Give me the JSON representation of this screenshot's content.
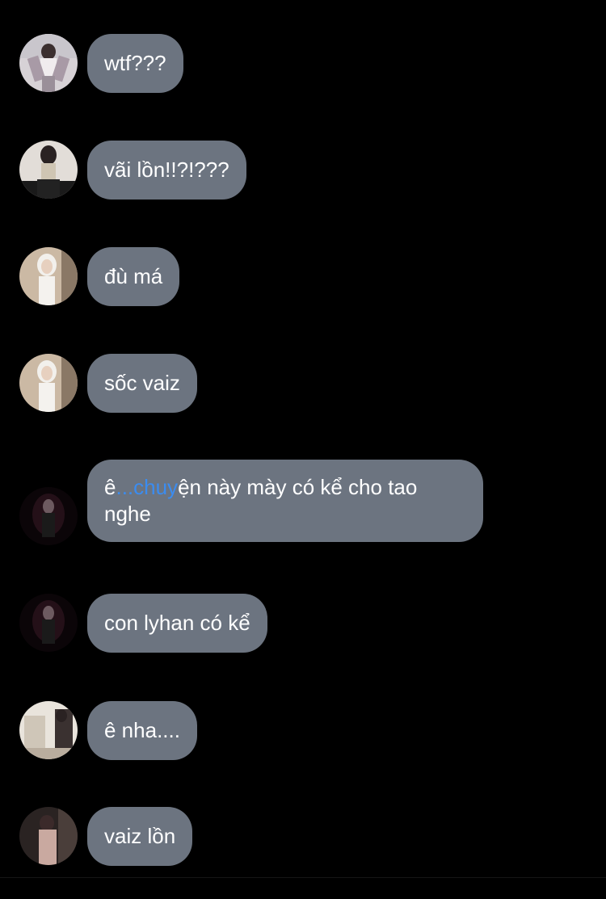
{
  "messages": [
    {
      "text": "wtf???",
      "avatar": "avatar-photo-1"
    },
    {
      "text": "vãi lồn!!?!???",
      "avatar": "avatar-photo-2"
    },
    {
      "text": "đù má",
      "avatar": "avatar-photo-3"
    },
    {
      "text": "sốc vaiz",
      "avatar": "avatar-photo-3"
    },
    {
      "text_before": "ê",
      "mention": "...chuy",
      "text_after": "ện này mày có kể cho tao nghe",
      "avatar": "avatar-photo-4"
    },
    {
      "text": "con lyhan có kể",
      "avatar": "avatar-photo-4"
    },
    {
      "text": "ê nha....",
      "avatar": "avatar-photo-5"
    },
    {
      "text": "vaiz lồn",
      "avatar": "avatar-photo-6"
    }
  ],
  "colors": {
    "background": "#000000",
    "bubble": "#6c7480",
    "text": "#ffffff",
    "mention": "#3b8cf0"
  }
}
